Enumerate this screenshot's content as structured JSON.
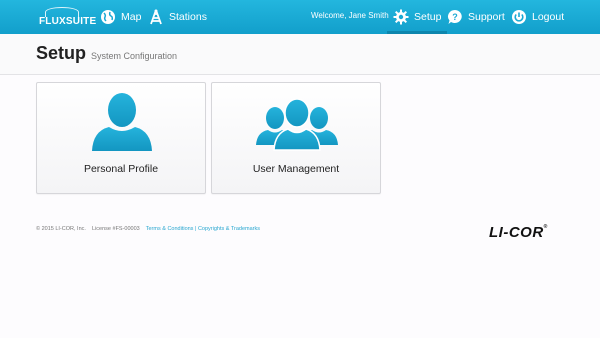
{
  "app": {
    "logo_text": "FLUXSUITE"
  },
  "nav": {
    "map_label": "Map",
    "stations_label": "Stations",
    "welcome_text": "Welcome, Jane Smith",
    "setup_label": "Setup",
    "support_label": "Support",
    "logout_label": "Logout",
    "active": "Setup"
  },
  "header": {
    "title": "Setup",
    "subtitle": "System Configuration"
  },
  "tiles": [
    {
      "label": "Personal Profile",
      "icon": "person-icon"
    },
    {
      "label": "User Management",
      "icon": "users-group-icon"
    }
  ],
  "footer": {
    "copyright": "© 2015 LI-COR, Inc.",
    "license": "License #FS-00003",
    "terms_link": "Terms & Conditions",
    "separator": "|",
    "copyrights_link": "Copyrights & Trademarks",
    "brand": "LI-COR"
  },
  "colors": {
    "accent": "#1aa9d4",
    "icon_blue": "#1a9fc9"
  }
}
